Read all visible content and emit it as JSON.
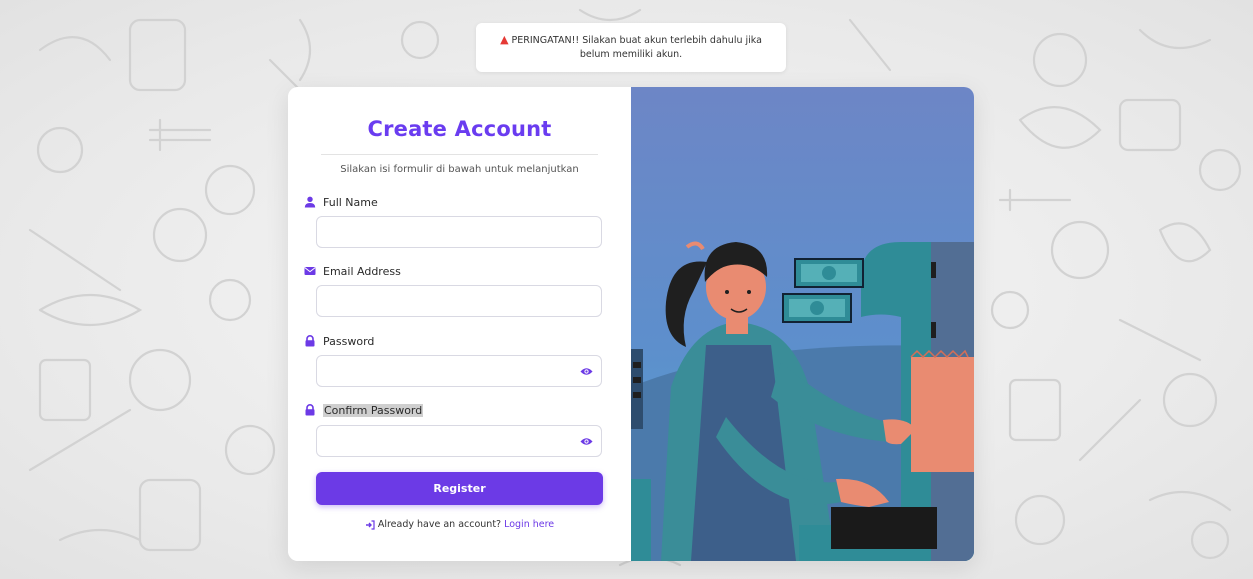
{
  "alert": {
    "prefix": "PERINGATAN!!",
    "message": "Silakan buat akun terlebih dahulu jika belum memiliki akun."
  },
  "form": {
    "title": "Create Account",
    "subtitle": "Silakan isi formulir di bawah untuk melanjutkan",
    "fields": [
      {
        "label": "Full Name",
        "icon": "user-icon",
        "value": "",
        "placeholder": ""
      },
      {
        "label": "Email Address",
        "icon": "envelope-icon",
        "value": "",
        "placeholder": ""
      },
      {
        "label": "Password",
        "icon": "lock-icon",
        "value": "",
        "placeholder": ""
      },
      {
        "label": "Confirm Password",
        "icon": "lock-icon",
        "value": "",
        "placeholder": ""
      }
    ],
    "register_label": "Register",
    "login_prompt": "Already have an account?",
    "login_link": "Login here"
  },
  "colors": {
    "accent": "#6c3ae6",
    "title": "#6a3cf0",
    "warning": "#e53935",
    "illustration_bg_top": "#6d86c6",
    "illustration_bg_bottom": "#5aa3cf"
  }
}
